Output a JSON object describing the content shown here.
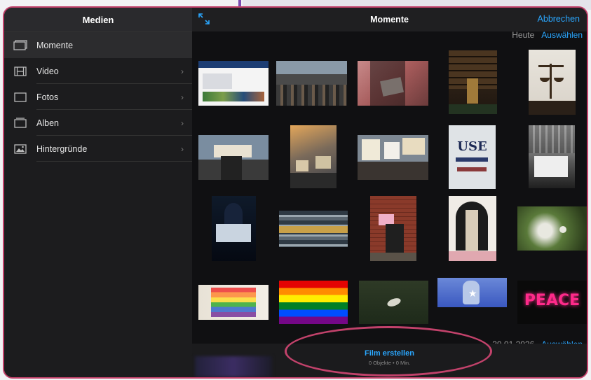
{
  "sidebar": {
    "title": "Medien",
    "items": [
      {
        "label": "Momente",
        "icon": "stack-icon",
        "active": true
      },
      {
        "label": "Video",
        "icon": "film-icon"
      },
      {
        "label": "Fotos",
        "icon": "photo-frame-icon"
      },
      {
        "label": "Alben",
        "icon": "album-icon"
      },
      {
        "label": "Hintergründe",
        "icon": "landscape-icon"
      }
    ]
  },
  "topbar": {
    "title": "Momente",
    "cancel": "Abbrechen"
  },
  "sections": [
    {
      "label": "Heute",
      "select": "Auswählen"
    },
    {
      "label": "30.01.2026",
      "select": "Auswählen"
    }
  ],
  "bottom": {
    "title": "Film erstellen",
    "subtitle": "0 Objekte • 0 Min."
  },
  "colors": {
    "accent": "#2aa7ff",
    "annotation": "#c2426b"
  }
}
